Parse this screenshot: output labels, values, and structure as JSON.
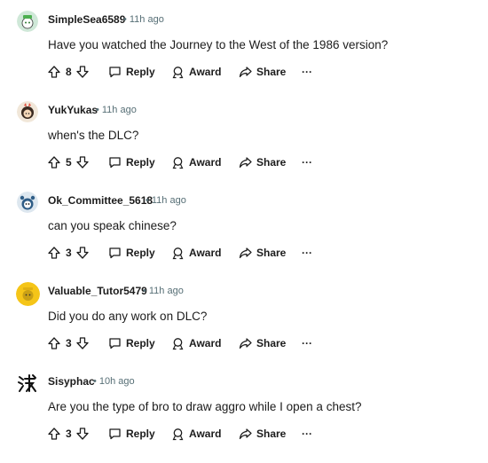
{
  "comments": [
    {
      "user": "SimpleSea6589",
      "time": "11h ago",
      "text": "Have you watched the Journey to the West of the 1986 version?",
      "score": "8",
      "avatar": "snoo-green-icon"
    },
    {
      "user": "YukYukas",
      "time": "11h ago",
      "text": "when's the DLC?",
      "score": "5",
      "avatar": "snoo-dark-hair-icon"
    },
    {
      "user": "Ok_Committee_5618",
      "time": "11h ago",
      "text": "can you speak chinese?",
      "score": "3",
      "avatar": "snoo-blue-icon"
    },
    {
      "user": "Valuable_Tutor5479",
      "time": "11h ago",
      "text": "Did you do any work on DLC?",
      "score": "3",
      "avatar": "snoo-yellow-icon"
    },
    {
      "user": "Sisyphac",
      "time": "10h ago",
      "text": "Are you the type of bro to draw aggro while I open a chest?",
      "score": "3",
      "avatar": "kanji-avatar-icon"
    }
  ],
  "actions": {
    "reply": "Reply",
    "award": "Award",
    "share": "Share",
    "more": "···"
  },
  "meta_separator": "•",
  "colors": {
    "text": "#1c1c1c",
    "meta": "#576f76"
  }
}
